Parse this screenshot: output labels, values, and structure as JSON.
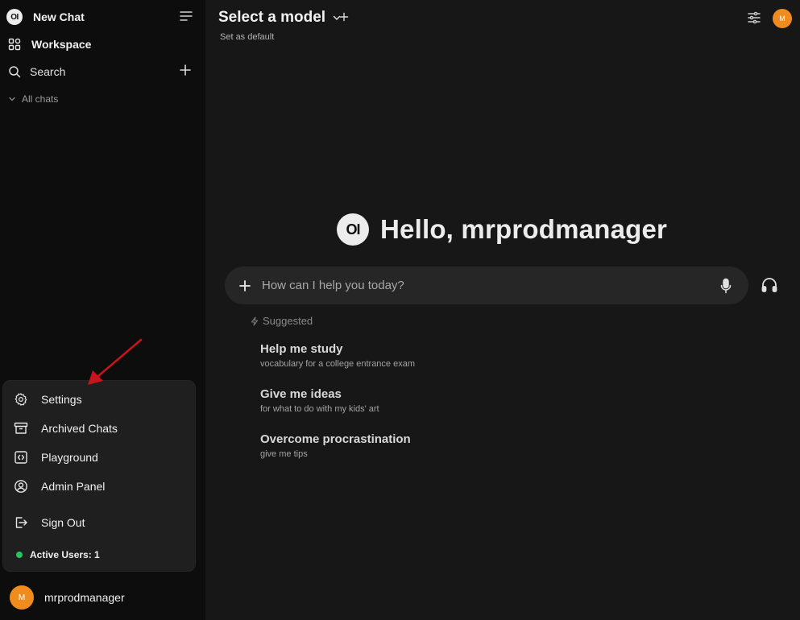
{
  "sidebar": {
    "logo_text": "OI",
    "new_chat": "New Chat",
    "workspace": "Workspace",
    "search": "Search",
    "all_chats": "All chats"
  },
  "user_menu": {
    "items": [
      {
        "label": "Settings",
        "icon": "gear-icon"
      },
      {
        "label": "Archived Chats",
        "icon": "archive-icon"
      },
      {
        "label": "Playground",
        "icon": "code-icon"
      },
      {
        "label": "Admin Panel",
        "icon": "user-circle-icon"
      },
      {
        "label": "Sign Out",
        "icon": "sign-out-icon"
      }
    ],
    "active_users": "Active Users: 1"
  },
  "user": {
    "name": "mrprodmanager",
    "avatar_initial": "M",
    "avatar_color": "#f08c1e"
  },
  "header": {
    "model_select": "Select a model",
    "set_default": "Set as default"
  },
  "main": {
    "logo_text": "OI",
    "greeting": "Hello, mrprodmanager",
    "input_placeholder": "How can I help you today?",
    "suggested_label": "Suggested",
    "suggestions": [
      {
        "title": "Help me study",
        "subtitle": "vocabulary for a college entrance exam"
      },
      {
        "title": "Give me ideas",
        "subtitle": "for what to do with my kids' art"
      },
      {
        "title": "Overcome procrastination",
        "subtitle": "give me tips"
      }
    ]
  },
  "colors": {
    "background": "#171717",
    "sidebar": "#0d0d0d",
    "menu": "#1f1f1f",
    "input": "#262626",
    "status_green": "#22c55e",
    "annotation_arrow": "#c8141b"
  }
}
